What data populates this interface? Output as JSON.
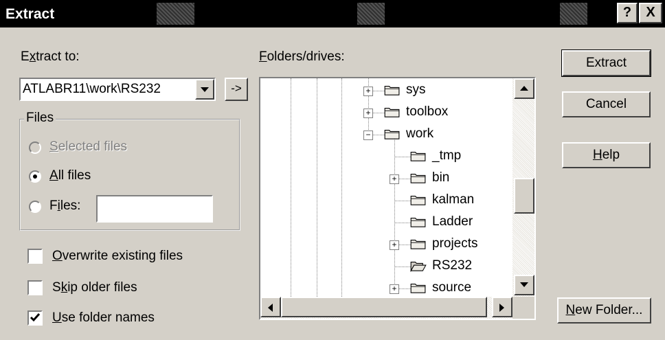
{
  "dialog": {
    "title": "Extract",
    "help_btn": "?",
    "close_btn": "X"
  },
  "extract_to": {
    "label": "Extract to:",
    "value": "ATLABR11\\work\\RS232",
    "browse_btn": "->"
  },
  "files": {
    "group_label": "Files",
    "selected_files": "Selected files",
    "all_files": "All files",
    "files_label": "Files:",
    "files_value": "",
    "selected_option": "All files"
  },
  "options": {
    "overwrite": {
      "label": "Overwrite existing files",
      "checked": false
    },
    "skip_older": {
      "label": "Skip older files",
      "checked": false
    },
    "use_folder_names": {
      "label": "Use folder names",
      "checked": true
    }
  },
  "folders": {
    "label": "Folders/drives:",
    "items": [
      {
        "name": "sys",
        "expander": "+"
      },
      {
        "name": "toolbox",
        "expander": "+"
      },
      {
        "name": "work",
        "expander": "−"
      },
      {
        "name": "_tmp",
        "expander": ""
      },
      {
        "name": "bin",
        "expander": "+"
      },
      {
        "name": "kalman",
        "expander": ""
      },
      {
        "name": "Ladder",
        "expander": ""
      },
      {
        "name": "projects",
        "expander": "+"
      },
      {
        "name": "RS232",
        "expander": "",
        "selected": true
      },
      {
        "name": "source",
        "expander": "+"
      }
    ]
  },
  "buttons": {
    "extract": "Extract",
    "cancel": "Cancel",
    "help": "Help",
    "new_folder": "New Folder..."
  },
  "icons": {
    "dropdown": "chevron-down-icon",
    "folder": "folder-icon",
    "open_folder": "open-folder-icon"
  }
}
